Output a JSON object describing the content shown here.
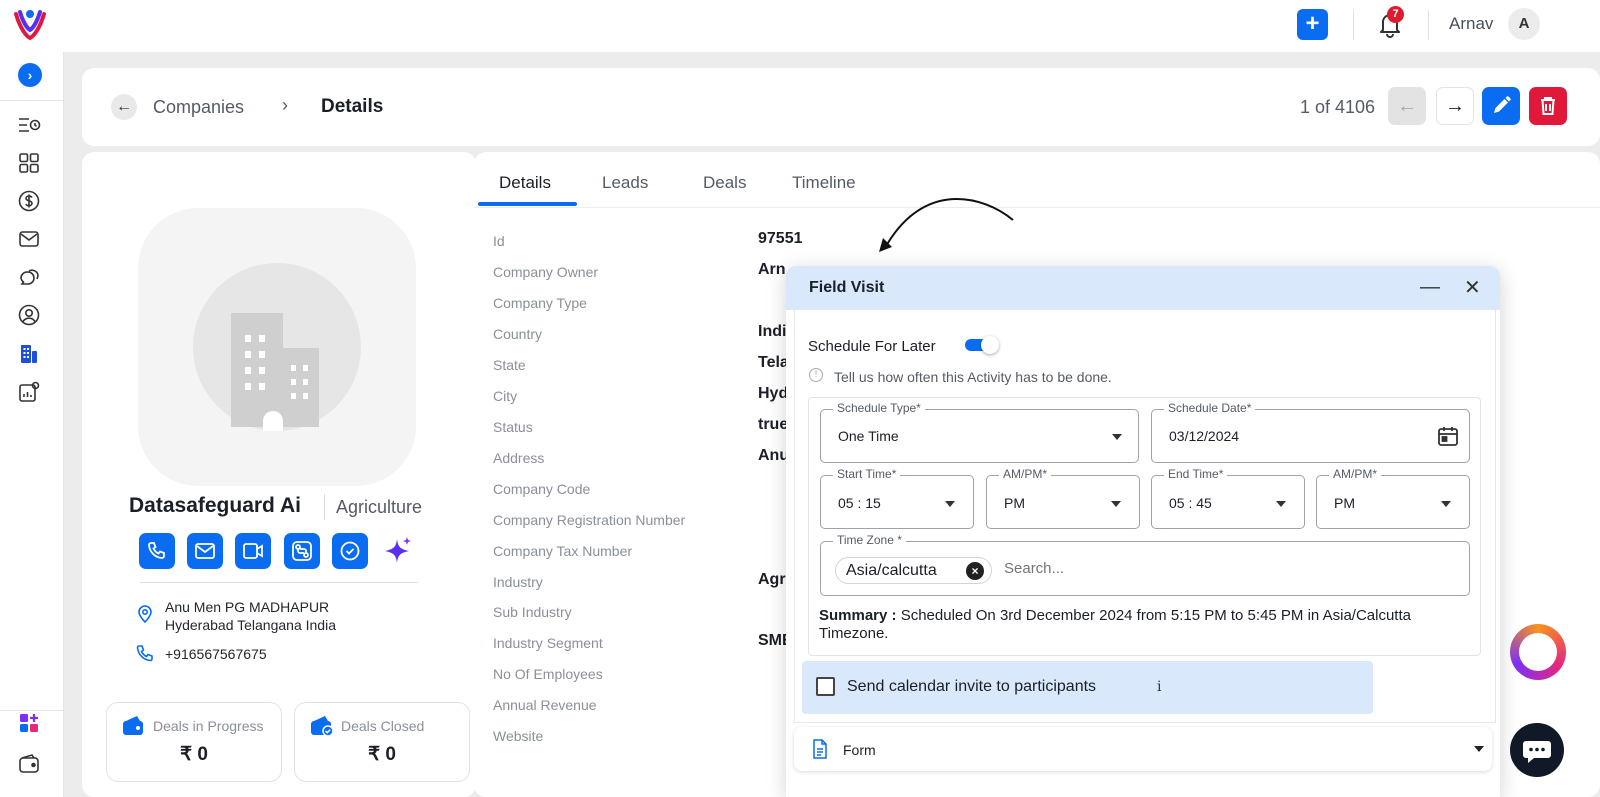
{
  "topbar": {
    "add_label": "+",
    "notifications_count": "7",
    "user_name": "Arnav",
    "avatar_initial": "A"
  },
  "header": {
    "back_icon": "arrow-left-icon",
    "crumb_parent": "Companies",
    "crumb_current": "Details",
    "pager": "1 of 4106"
  },
  "profile": {
    "name": "Datasafeguard Ai",
    "industry": "Agriculture",
    "address_line1": "Anu Men PG MADHAPUR",
    "address_line2": "Hyderabad Telangana India",
    "phone": "+916567567675",
    "stats": [
      {
        "label": "Deals in Progress",
        "value": "₹ 0"
      },
      {
        "label": "Deals Closed",
        "value": "₹ 0"
      }
    ]
  },
  "tabs": [
    {
      "label": "Details",
      "active": true
    },
    {
      "label": "Leads",
      "active": false
    },
    {
      "label": "Deals",
      "active": false
    },
    {
      "label": "Timeline",
      "active": false
    }
  ],
  "fields": [
    {
      "label": "Id",
      "value": "97551"
    },
    {
      "label": "Company Owner",
      "value": "Arn"
    },
    {
      "label": "Company Type",
      "value": ""
    },
    {
      "label": "Country",
      "value": "Indi"
    },
    {
      "label": "State",
      "value": "Tela"
    },
    {
      "label": "City",
      "value": "Hyd"
    },
    {
      "label": "Status",
      "value": "true"
    },
    {
      "label": "Address",
      "value": "Anu"
    },
    {
      "label": "Company Code",
      "value": ""
    },
    {
      "label": "Company Registration Number",
      "value": ""
    },
    {
      "label": "Company Tax Number",
      "value": ""
    },
    {
      "label": "Industry",
      "value": "Agr"
    },
    {
      "label": "Sub Industry",
      "value": ""
    },
    {
      "label": "Industry Segment",
      "value": "SME"
    },
    {
      "label": "No Of Employees",
      "value": ""
    },
    {
      "label": "Annual Revenue",
      "value": ""
    },
    {
      "label": "Website",
      "value": ""
    }
  ],
  "modal": {
    "title": "Field Visit",
    "minimize": "—",
    "close": "✕",
    "schedule_label": "Schedule For Later",
    "schedule_enabled": true,
    "hint": "Tell us how often this Activity has to be done.",
    "schedule_type": {
      "label": "Schedule Type",
      "value": "One Time"
    },
    "schedule_date": {
      "label": "Schedule Date",
      "value": "03/12/2024"
    },
    "start_time": {
      "label": "Start Time",
      "value": "05 : 15"
    },
    "start_ampm": {
      "label": "AM/PM",
      "value": "PM"
    },
    "end_time": {
      "label": "End Time",
      "value": "05 : 45"
    },
    "end_ampm": {
      "label": "AM/PM",
      "value": "PM"
    },
    "time_zone": {
      "label": "Time Zone",
      "chip": "Asia/calcutta",
      "placeholder": "Search..."
    },
    "summary_label": "Summary :",
    "summary_text": "Scheduled On 3rd December 2024 from 5:15 PM to 5:45 PM in Asia/Calcutta Timezone.",
    "invite_label": "Send calendar invite to participants",
    "invite_info": "i",
    "form_label": "Form"
  },
  "colors": {
    "primary": "#0a6cf0",
    "danger": "#e0193a",
    "modal_header": "#d9e8fb"
  }
}
